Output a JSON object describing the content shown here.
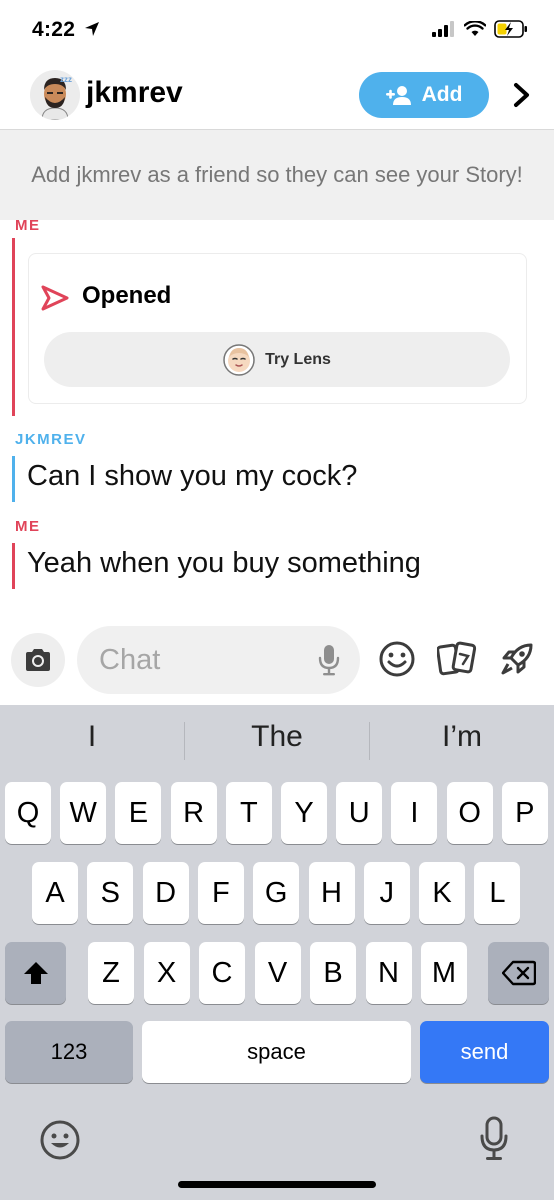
{
  "status_bar": {
    "time": "4:22"
  },
  "header": {
    "username": "jkmrev",
    "add_label": "Add"
  },
  "banner": {
    "text": "Add jkmrev as a friend so they can see your Story!"
  },
  "chat": {
    "snap_block": {
      "sender": "ME",
      "status": "Opened",
      "lens_label": "Try Lens"
    },
    "messages": [
      {
        "sender": "JKMREV",
        "text": "Can I show you my cock?"
      },
      {
        "sender": "ME",
        "text": "Yeah when you buy something"
      }
    ]
  },
  "input": {
    "placeholder": "Chat"
  },
  "keyboard": {
    "suggestions": [
      "I",
      "The",
      "I’m"
    ],
    "row1": [
      "Q",
      "W",
      "E",
      "R",
      "T",
      "Y",
      "U",
      "I",
      "O",
      "P"
    ],
    "row2": [
      "A",
      "S",
      "D",
      "F",
      "G",
      "H",
      "J",
      "K",
      "L"
    ],
    "row3": [
      "Z",
      "X",
      "C",
      "V",
      "B",
      "N",
      "M"
    ],
    "numbers_label": "123",
    "space_label": "space",
    "send_label": "send"
  },
  "colors": {
    "me": "#e04459",
    "them": "#4fb1ec",
    "send": "#3478f6",
    "add": "#4fb1ec"
  },
  "icons": [
    "location-arrow-icon",
    "signal-icon",
    "wifi-icon",
    "battery-charging-icon",
    "add-friend-icon",
    "chevron-right-icon",
    "sent-arrow-icon",
    "lens-face-icon",
    "camera-icon",
    "microphone-icon",
    "emoji-icon",
    "sticker-cards-icon",
    "rocket-icon",
    "shift-icon",
    "backspace-icon"
  ]
}
